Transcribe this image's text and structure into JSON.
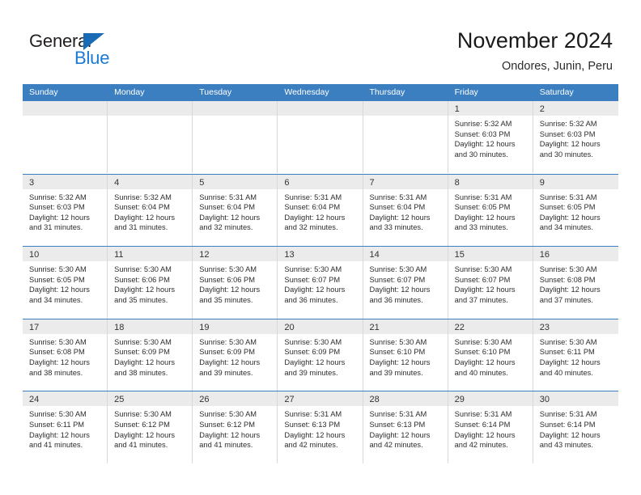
{
  "brand": {
    "name_top": "General",
    "name_bottom": "Blue",
    "triangle_color": "#1a6bb5",
    "blue_text_color": "#1a7ad4"
  },
  "header": {
    "title": "November 2024",
    "subtitle": "Ondores, Junin, Peru"
  },
  "theme": {
    "header_band": "#3c7fc1",
    "day_strip": "#ebebeb",
    "cell_border": "#d8d8d8"
  },
  "calendar": {
    "weekday_headers": [
      "Sunday",
      "Monday",
      "Tuesday",
      "Wednesday",
      "Thursday",
      "Friday",
      "Saturday"
    ],
    "weeks": [
      [
        {
          "day": "",
          "sunrise": "",
          "sunset": "",
          "daylight_line1": "",
          "daylight_line2": ""
        },
        {
          "day": "",
          "sunrise": "",
          "sunset": "",
          "daylight_line1": "",
          "daylight_line2": ""
        },
        {
          "day": "",
          "sunrise": "",
          "sunset": "",
          "daylight_line1": "",
          "daylight_line2": ""
        },
        {
          "day": "",
          "sunrise": "",
          "sunset": "",
          "daylight_line1": "",
          "daylight_line2": ""
        },
        {
          "day": "",
          "sunrise": "",
          "sunset": "",
          "daylight_line1": "",
          "daylight_line2": ""
        },
        {
          "day": "1",
          "sunrise": "Sunrise: 5:32 AM",
          "sunset": "Sunset: 6:03 PM",
          "daylight_line1": "Daylight: 12 hours",
          "daylight_line2": "and 30 minutes."
        },
        {
          "day": "2",
          "sunrise": "Sunrise: 5:32 AM",
          "sunset": "Sunset: 6:03 PM",
          "daylight_line1": "Daylight: 12 hours",
          "daylight_line2": "and 30 minutes."
        }
      ],
      [
        {
          "day": "3",
          "sunrise": "Sunrise: 5:32 AM",
          "sunset": "Sunset: 6:03 PM",
          "daylight_line1": "Daylight: 12 hours",
          "daylight_line2": "and 31 minutes."
        },
        {
          "day": "4",
          "sunrise": "Sunrise: 5:32 AM",
          "sunset": "Sunset: 6:04 PM",
          "daylight_line1": "Daylight: 12 hours",
          "daylight_line2": "and 31 minutes."
        },
        {
          "day": "5",
          "sunrise": "Sunrise: 5:31 AM",
          "sunset": "Sunset: 6:04 PM",
          "daylight_line1": "Daylight: 12 hours",
          "daylight_line2": "and 32 minutes."
        },
        {
          "day": "6",
          "sunrise": "Sunrise: 5:31 AM",
          "sunset": "Sunset: 6:04 PM",
          "daylight_line1": "Daylight: 12 hours",
          "daylight_line2": "and 32 minutes."
        },
        {
          "day": "7",
          "sunrise": "Sunrise: 5:31 AM",
          "sunset": "Sunset: 6:04 PM",
          "daylight_line1": "Daylight: 12 hours",
          "daylight_line2": "and 33 minutes."
        },
        {
          "day": "8",
          "sunrise": "Sunrise: 5:31 AM",
          "sunset": "Sunset: 6:05 PM",
          "daylight_line1": "Daylight: 12 hours",
          "daylight_line2": "and 33 minutes."
        },
        {
          "day": "9",
          "sunrise": "Sunrise: 5:31 AM",
          "sunset": "Sunset: 6:05 PM",
          "daylight_line1": "Daylight: 12 hours",
          "daylight_line2": "and 34 minutes."
        }
      ],
      [
        {
          "day": "10",
          "sunrise": "Sunrise: 5:30 AM",
          "sunset": "Sunset: 6:05 PM",
          "daylight_line1": "Daylight: 12 hours",
          "daylight_line2": "and 34 minutes."
        },
        {
          "day": "11",
          "sunrise": "Sunrise: 5:30 AM",
          "sunset": "Sunset: 6:06 PM",
          "daylight_line1": "Daylight: 12 hours",
          "daylight_line2": "and 35 minutes."
        },
        {
          "day": "12",
          "sunrise": "Sunrise: 5:30 AM",
          "sunset": "Sunset: 6:06 PM",
          "daylight_line1": "Daylight: 12 hours",
          "daylight_line2": "and 35 minutes."
        },
        {
          "day": "13",
          "sunrise": "Sunrise: 5:30 AM",
          "sunset": "Sunset: 6:07 PM",
          "daylight_line1": "Daylight: 12 hours",
          "daylight_line2": "and 36 minutes."
        },
        {
          "day": "14",
          "sunrise": "Sunrise: 5:30 AM",
          "sunset": "Sunset: 6:07 PM",
          "daylight_line1": "Daylight: 12 hours",
          "daylight_line2": "and 36 minutes."
        },
        {
          "day": "15",
          "sunrise": "Sunrise: 5:30 AM",
          "sunset": "Sunset: 6:07 PM",
          "daylight_line1": "Daylight: 12 hours",
          "daylight_line2": "and 37 minutes."
        },
        {
          "day": "16",
          "sunrise": "Sunrise: 5:30 AM",
          "sunset": "Sunset: 6:08 PM",
          "daylight_line1": "Daylight: 12 hours",
          "daylight_line2": "and 37 minutes."
        }
      ],
      [
        {
          "day": "17",
          "sunrise": "Sunrise: 5:30 AM",
          "sunset": "Sunset: 6:08 PM",
          "daylight_line1": "Daylight: 12 hours",
          "daylight_line2": "and 38 minutes."
        },
        {
          "day": "18",
          "sunrise": "Sunrise: 5:30 AM",
          "sunset": "Sunset: 6:09 PM",
          "daylight_line1": "Daylight: 12 hours",
          "daylight_line2": "and 38 minutes."
        },
        {
          "day": "19",
          "sunrise": "Sunrise: 5:30 AM",
          "sunset": "Sunset: 6:09 PM",
          "daylight_line1": "Daylight: 12 hours",
          "daylight_line2": "and 39 minutes."
        },
        {
          "day": "20",
          "sunrise": "Sunrise: 5:30 AM",
          "sunset": "Sunset: 6:09 PM",
          "daylight_line1": "Daylight: 12 hours",
          "daylight_line2": "and 39 minutes."
        },
        {
          "day": "21",
          "sunrise": "Sunrise: 5:30 AM",
          "sunset": "Sunset: 6:10 PM",
          "daylight_line1": "Daylight: 12 hours",
          "daylight_line2": "and 39 minutes."
        },
        {
          "day": "22",
          "sunrise": "Sunrise: 5:30 AM",
          "sunset": "Sunset: 6:10 PM",
          "daylight_line1": "Daylight: 12 hours",
          "daylight_line2": "and 40 minutes."
        },
        {
          "day": "23",
          "sunrise": "Sunrise: 5:30 AM",
          "sunset": "Sunset: 6:11 PM",
          "daylight_line1": "Daylight: 12 hours",
          "daylight_line2": "and 40 minutes."
        }
      ],
      [
        {
          "day": "24",
          "sunrise": "Sunrise: 5:30 AM",
          "sunset": "Sunset: 6:11 PM",
          "daylight_line1": "Daylight: 12 hours",
          "daylight_line2": "and 41 minutes."
        },
        {
          "day": "25",
          "sunrise": "Sunrise: 5:30 AM",
          "sunset": "Sunset: 6:12 PM",
          "daylight_line1": "Daylight: 12 hours",
          "daylight_line2": "and 41 minutes."
        },
        {
          "day": "26",
          "sunrise": "Sunrise: 5:30 AM",
          "sunset": "Sunset: 6:12 PM",
          "daylight_line1": "Daylight: 12 hours",
          "daylight_line2": "and 41 minutes."
        },
        {
          "day": "27",
          "sunrise": "Sunrise: 5:31 AM",
          "sunset": "Sunset: 6:13 PM",
          "daylight_line1": "Daylight: 12 hours",
          "daylight_line2": "and 42 minutes."
        },
        {
          "day": "28",
          "sunrise": "Sunrise: 5:31 AM",
          "sunset": "Sunset: 6:13 PM",
          "daylight_line1": "Daylight: 12 hours",
          "daylight_line2": "and 42 minutes."
        },
        {
          "day": "29",
          "sunrise": "Sunrise: 5:31 AM",
          "sunset": "Sunset: 6:14 PM",
          "daylight_line1": "Daylight: 12 hours",
          "daylight_line2": "and 42 minutes."
        },
        {
          "day": "30",
          "sunrise": "Sunrise: 5:31 AM",
          "sunset": "Sunset: 6:14 PM",
          "daylight_line1": "Daylight: 12 hours",
          "daylight_line2": "and 43 minutes."
        }
      ]
    ]
  }
}
